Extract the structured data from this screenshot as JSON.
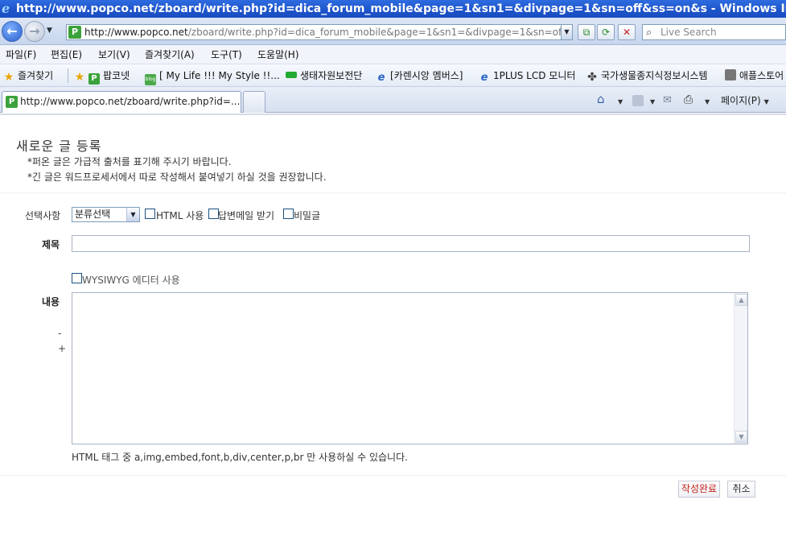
{
  "window": {
    "title": "http://www.popco.net/zboard/write.php?id=dica_forum_mobile&page=1&sn1=&divpage=1&sn=off&ss=on&s - Windows Internet Explorer"
  },
  "address_bar": {
    "url_host": "http://www.popco.net",
    "url_path": "/zboard/write.php?id=dica_forum_mobile&page=1&sn1=&divpage=1&sn=off&ss=on&",
    "search_placeholder": "Live Search"
  },
  "menu": [
    "파일(F)",
    "편집(E)",
    "보기(V)",
    "즐겨찾기(A)",
    "도구(T)",
    "도움말(H)"
  ],
  "favorites": {
    "label": "즐겨찾기",
    "items": [
      "팝코넷",
      "[ My Life !!! My Style !!...",
      "생태자원보전단",
      "[카렌시앙 멤버스]",
      "1PLUS LCD 모니터",
      "국가생물종지식정보시스템",
      "애플스토어"
    ]
  },
  "tabs": {
    "active_title": "http://www.popco.net/zboard/write.php?id=..."
  },
  "commands": {
    "page_label": "페이지(P)"
  },
  "page": {
    "title": "새로운 글 등록",
    "notes": [
      "*퍼온 글은 가급적 출처를 표기해 주시기 바랍니다.",
      "*긴 글은 워드프로세서에서 따로 작성해서 붙여넣기 하실 것을 권장합니다."
    ],
    "options_label": "선택사항",
    "category_selected": "분류선택",
    "html_label": "HTML 사용",
    "reply_mail_label": "답변메일 받기",
    "secret_label": "비밀글",
    "subject_label": "제목",
    "wysiwyg_label": "WYSIWYG 에디터 사용",
    "content_label": "내용",
    "shrink_label": "-",
    "grow_label": "+",
    "html_tag_note": "HTML 태그 중 a,img,embed,font,b,div,center,p,br 만 사용하실 수 있습니다.",
    "submit_label": "작성완료",
    "cancel_label": "취소"
  },
  "colors": {
    "titlebar": "#1d53c9",
    "submit_text": "#c0201a"
  }
}
